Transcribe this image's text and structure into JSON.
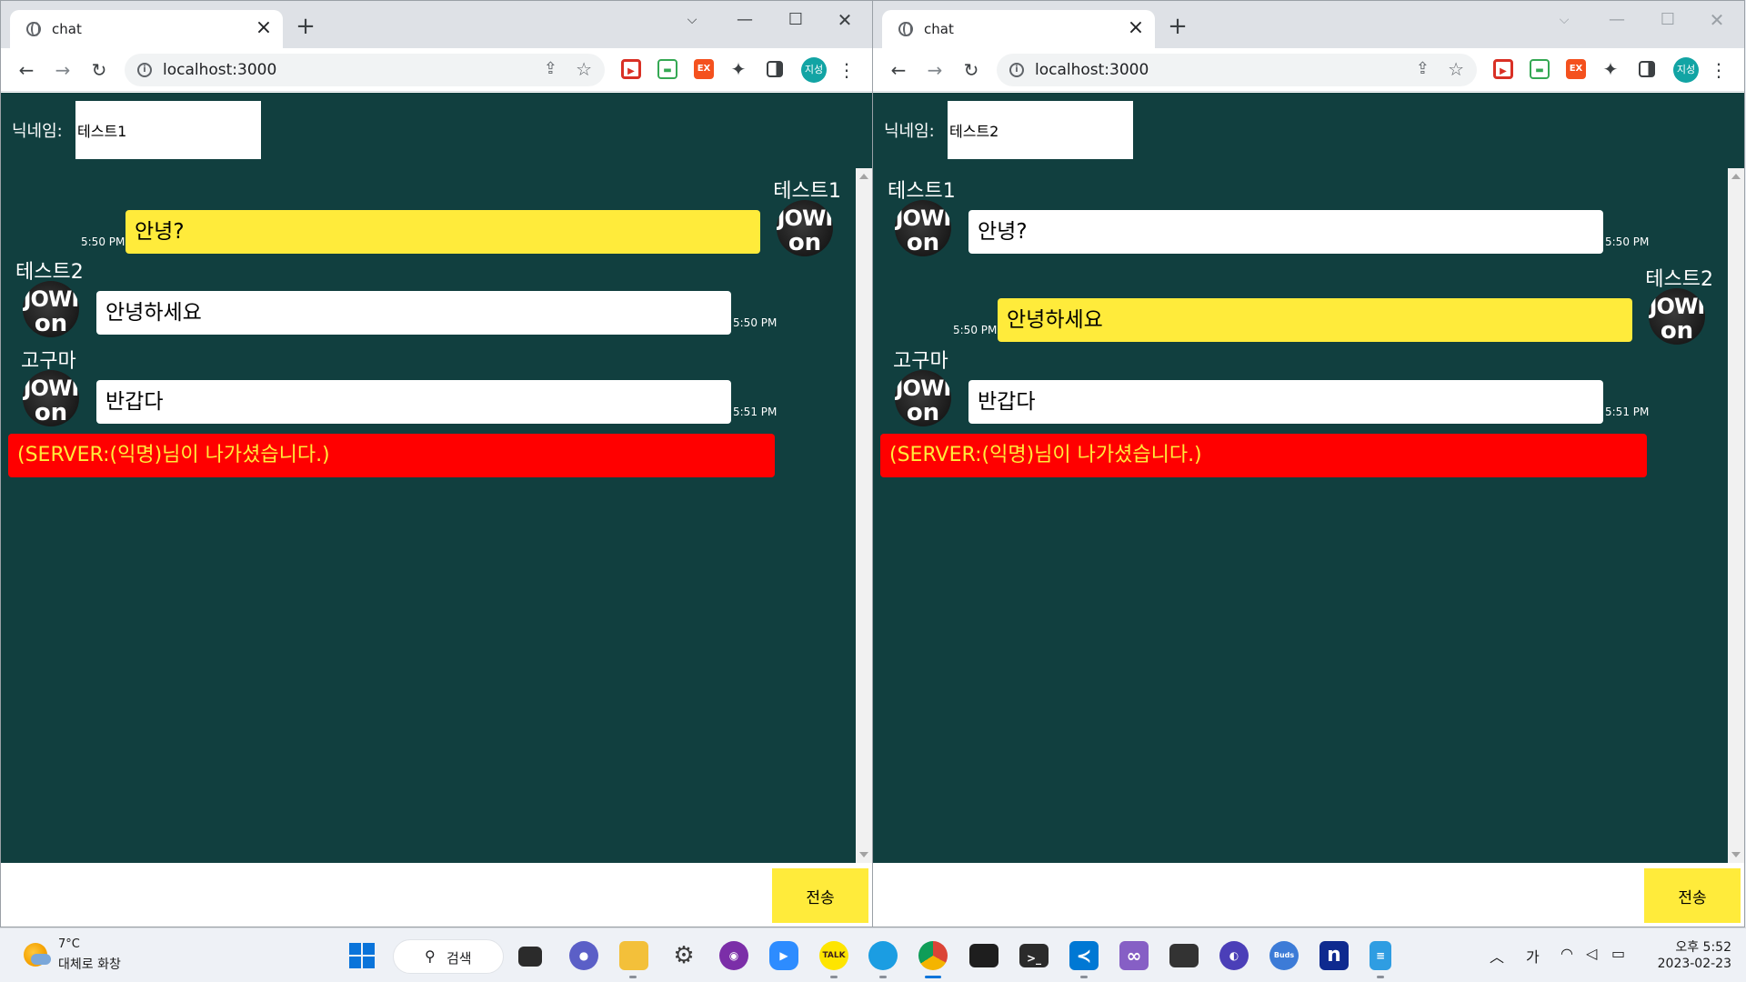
{
  "browser": {
    "tab_title": "chat",
    "url": "localhost:3000",
    "profile_initials": "지성",
    "ext_3_label": "EX"
  },
  "chat": {
    "nickname_label": "닉네임:",
    "send_label": "전송",
    "avatar_line1": "JOWI",
    "avatar_line2": "on"
  },
  "left_window": {
    "nickname_value": "테스트1",
    "messages": [
      {
        "sender": "테스트1",
        "text": "안녕?",
        "time": "5:50 PM",
        "mine": true
      },
      {
        "sender": "테스트2",
        "text": "안녕하세요",
        "time": "5:50 PM",
        "mine": false
      },
      {
        "sender": "고구마",
        "text": "반갑다",
        "time": "5:51 PM",
        "mine": false
      }
    ],
    "server_message": "(SERVER:(익명)님이 나가셨습니다.)"
  },
  "right_window": {
    "nickname_value": "테스트2",
    "messages": [
      {
        "sender": "테스트1",
        "text": "안녕?",
        "time": "5:50 PM",
        "mine": false
      },
      {
        "sender": "테스트2",
        "text": "안녕하세요",
        "time": "5:50 PM",
        "mine": true
      },
      {
        "sender": "고구마",
        "text": "반갑다",
        "time": "5:51 PM",
        "mine": false
      }
    ],
    "server_message": "(SERVER:(익명)님이 나가셨습니다.)"
  },
  "taskbar": {
    "weather_temp": "7°C",
    "weather_desc": "대체로 화창",
    "search_label": "검색",
    "apps": [
      "task-view",
      "meet",
      "file-explorer",
      "settings",
      "github-desktop",
      "zoom",
      "kakaotalk",
      "edge",
      "chrome",
      "terminal",
      "powershell",
      "vscode",
      "visual-studio",
      "mysql",
      "app-moon",
      "buds",
      "notion",
      "notepad"
    ],
    "active_app": "chrome",
    "kakao_label": "TALK",
    "buds_label": "Buds",
    "notion_label": "n",
    "ime_label": "가",
    "clock_time": "오후 5:52",
    "clock_date": "2023-02-23"
  },
  "colors": {
    "page_bg": "#113f3f",
    "mine_bubble": "#ffeb3b",
    "other_bubble": "#ffffff",
    "server_bg": "#ff0000",
    "server_text": "#ffeb3b",
    "send_button": "#ffeb3b"
  }
}
